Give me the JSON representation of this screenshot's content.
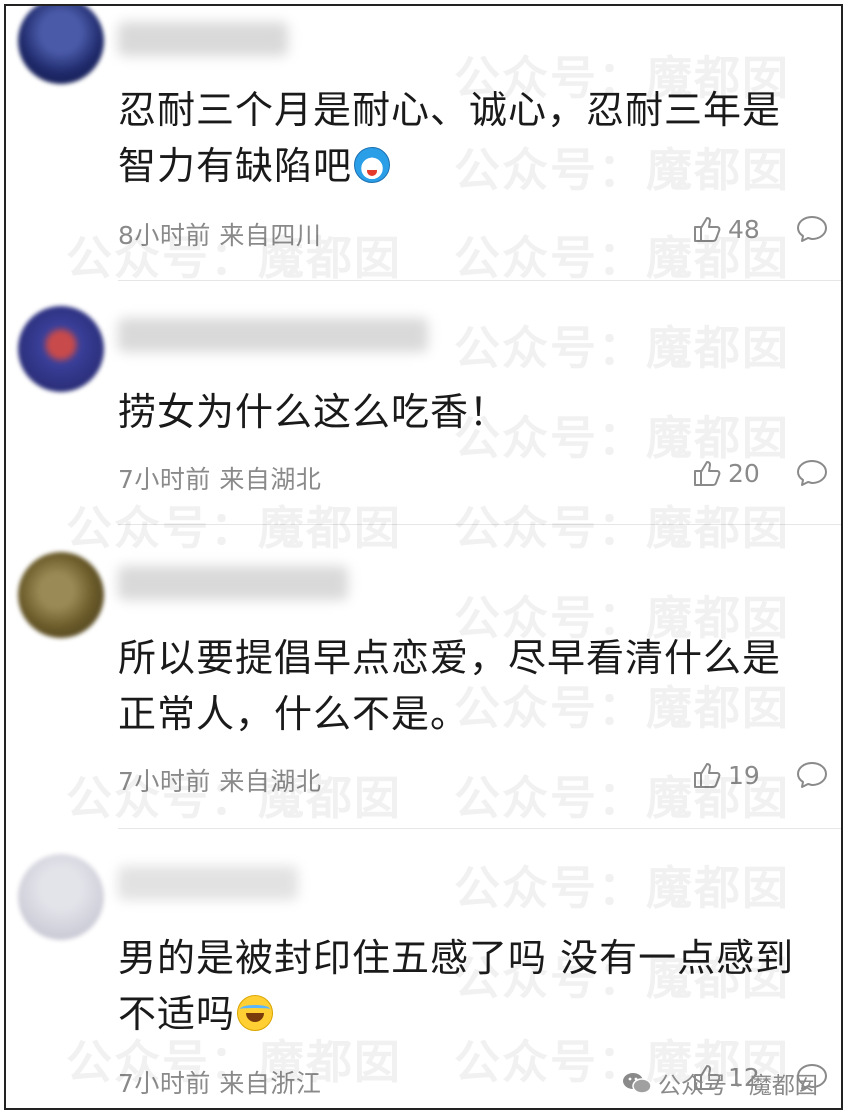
{
  "comments": [
    {
      "text_line1": "忍耐三个月是耐心、诚心，忍耐三年是",
      "text_line2": "智力有缺陷吧",
      "emoji": "doraemon-emoji",
      "meta": "8小时前 来自四川",
      "likes": "48",
      "avatar_color": "#1f2a6b"
    },
    {
      "text_line1": "捞女为什么这么吃香！",
      "meta": "7小时前 来自湖北",
      "likes": "20",
      "avatar_color": "#2b2f7a"
    },
    {
      "text_line1": "所以要提倡早点恋爱，尽早看清什么是",
      "text_line2": "正常人，什么不是。",
      "meta": "7小时前 来自湖北",
      "likes": "19",
      "avatar_color": "#6b5b2a"
    },
    {
      "text_line1": "男的是被封印住五感了吗 没有一点感到",
      "text_line2": "不适吗",
      "emoji": "laughing-tears-emoji",
      "meta": "7小时前 来自浙江",
      "likes": "12",
      "avatar_color": "#d3d3dd"
    }
  ],
  "watermark": {
    "text": "公众号：魔都囡",
    "footer_label": "公众号 · 魔都囡"
  },
  "colors": {
    "text": "#1a1a1a",
    "meta": "#8a8a8a",
    "divider": "#e6e6e6"
  }
}
